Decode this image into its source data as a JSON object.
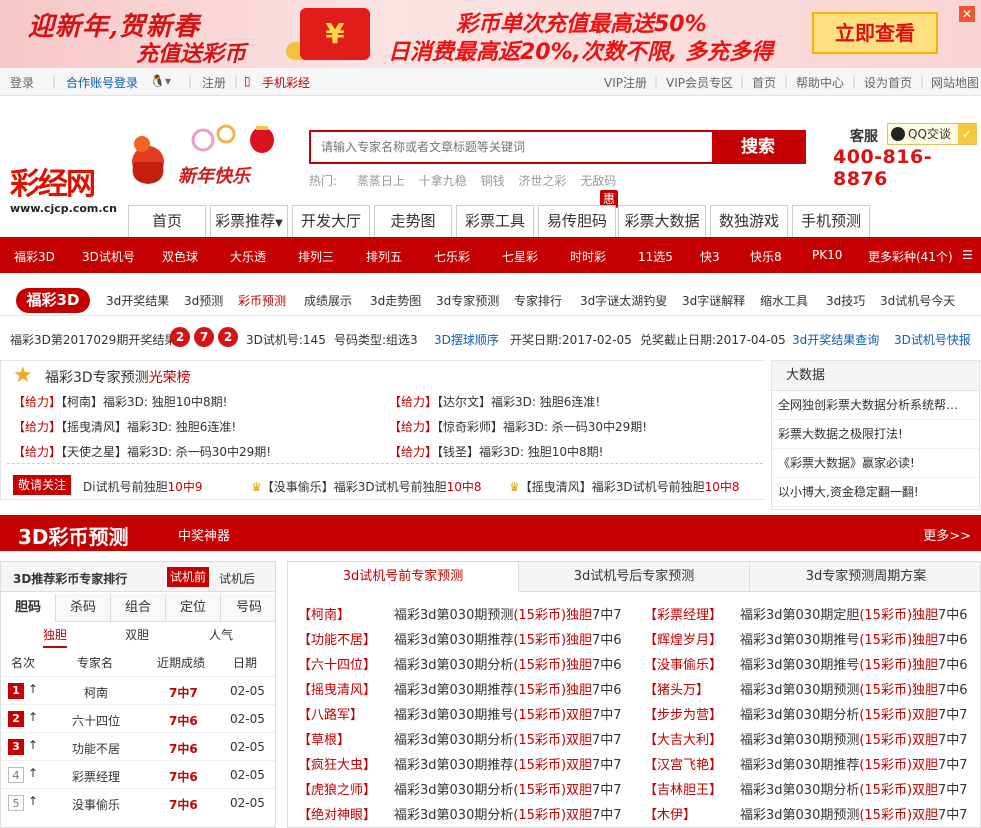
{
  "banner": {
    "title1": "迎新年,贺新春",
    "title2": "充值送彩币",
    "line1": "彩币单次充值最高送50%",
    "line2": "日消费最高返20%,次数不限, 多充多得",
    "cta": "立即查看",
    "envelope": "¥"
  },
  "topbar": {
    "login": "登录",
    "partner": "合作账号登录",
    "register": "注册",
    "mobile": "手机彩经",
    "vip_register": "VIP注册",
    "vip_zone": "VIP会员专区",
    "home": "首页",
    "help": "帮助中心",
    "set_home": "设为首页",
    "sitemap": "网站地图"
  },
  "header": {
    "logo_text": "彩经网",
    "logo_url": "www.cjcp.com.cn",
    "search_placeholder": "请输入专家名称或者文章标题等关键词",
    "search_btn": "搜索",
    "hot_label": "热门:",
    "hot": [
      "蒸蒸日上",
      "十拿九稳",
      "铜钱",
      "济世之彩",
      "无敌码"
    ],
    "kefu": "客服",
    "qq": "QQ交谈",
    "phone": "400-816-8876",
    "rooster_text": "新年快乐"
  },
  "mainnav": {
    "items": [
      "首页",
      "彩票推荐",
      "开发大厅",
      "走势图",
      "彩票工具",
      "易传胆码",
      "彩票大数据",
      "数独游戏",
      "手机预测"
    ],
    "badge": "惠"
  },
  "lotbar": {
    "items": [
      "福彩3D",
      "3D试机号",
      "双色球",
      "大乐透",
      "排列三",
      "排列五",
      "七乐彩",
      "七星彩",
      "时时彩",
      "11选5",
      "快3",
      "快乐8",
      "PK10",
      "更多彩种(41个)"
    ]
  },
  "subnav": {
    "pill": "福彩3D",
    "items": [
      "3d开奖结果",
      "3d预测",
      "彩币预测",
      "成绩展示",
      "3d走势图",
      "3d专家预测",
      "专家排行",
      "3d字谜太湖钓叟",
      "3d字谜解释",
      "缩水工具",
      "3d技巧",
      "3d试机号今天"
    ]
  },
  "result": {
    "issue": "福彩3D第2017029期开奖结果:",
    "balls": [
      "2",
      "7",
      "2"
    ],
    "test": "3D试机号:145",
    "type": "号码类型:组选3",
    "order": "3D摆球顺序",
    "date": "开奖日期:2017-02-05",
    "deadline": "兑奖截止日期:2017-04-05",
    "link1": "3d开奖结果查询",
    "link2": "3D试机号快报"
  },
  "experts": {
    "title_a": "福彩3D专家预测",
    "title_b": "光荣榜",
    "items": [
      {
        "tag": "【给力】",
        "name": "【柯南】",
        "text": "福彩3D: 独胆10中8期!"
      },
      {
        "tag": "【给力】",
        "name": "【达尔文】",
        "text": "福彩3D: 独胆6连准!"
      },
      {
        "tag": "【给力】",
        "name": "【摇曳清风】",
        "text": "福彩3D: 独胆6连准!"
      },
      {
        "tag": "【给力】",
        "name": "【惊奇彩师】",
        "text": "福彩3D: 杀一码30中29期!"
      },
      {
        "tag": "【给力】",
        "name": "【天使之星】",
        "text": "福彩3D: 杀一码30中29期!"
      },
      {
        "tag": "【给力】",
        "name": "【钱圣】",
        "text": "福彩3D: 独胆10中8期!"
      }
    ],
    "follow": "敬请关注",
    "f1a": "Di试机号前独胆",
    "f1b": "10中9",
    "f2a": "【没事偷乐】福彩3D试机号前独胆",
    "f2b": "10中8",
    "f3a": "【摇曳清风】福彩3D试机号前独胆",
    "f3b": "10中8"
  },
  "bigdata": {
    "title": "大数据",
    "rows": [
      "全网独创彩票大数据分析系统帮…",
      "彩票大数据之极限打法!",
      "《彩票大数据》赢家必读!",
      "以小博大,资金稳定翻一翻!"
    ]
  },
  "section": {
    "title": "3D彩币预测",
    "sub": "中奖神器",
    "more": "更多>>"
  },
  "rank": {
    "title": "3D推荐彩币专家排行",
    "before": "试机前",
    "after": "试机后",
    "tabs": [
      "胆码",
      "杀码",
      "组合",
      "定位",
      "号码"
    ],
    "subtabs": [
      "独胆",
      "双胆",
      "人气"
    ],
    "headers": [
      "名次",
      "专家名",
      "近期成绩",
      "日期"
    ],
    "rows": [
      {
        "n": "1",
        "name": "柯南",
        "res": "7中7",
        "date": "02-05"
      },
      {
        "n": "2",
        "name": "六十四位",
        "res": "7中6",
        "date": "02-05"
      },
      {
        "n": "3",
        "name": "功能不居",
        "res": "7中6",
        "date": "02-05"
      },
      {
        "n": "4",
        "name": "彩票经理",
        "res": "7中6",
        "date": "02-05"
      },
      {
        "n": "5",
        "name": "没事偷乐",
        "res": "7中6",
        "date": "02-05"
      }
    ],
    "arrow": "↑"
  },
  "pred": {
    "tabs": [
      "3d试机号前专家预测",
      "3d试机号后专家预测",
      "3d专家预测周期方案"
    ],
    "left": [
      {
        "n": "【柯南】",
        "a": "福彩3d第030期预测",
        "c": "(15彩币)独胆",
        "r": "7中7"
      },
      {
        "n": "【功能不居】",
        "a": "福彩3d第030期推荐",
        "c": "(15彩币)独胆",
        "r": "7中6"
      },
      {
        "n": "【六十四位】",
        "a": "福彩3d第030期分析",
        "c": "(15彩币)独胆",
        "r": "7中6"
      },
      {
        "n": "【摇曳清风】",
        "a": "福彩3d第030期推荐",
        "c": "(15彩币)独胆",
        "r": "7中6"
      },
      {
        "n": "【八路军】",
        "a": "福彩3d第030期推号",
        "c": "(15彩币)双胆",
        "r": "7中7"
      },
      {
        "n": "【草根】",
        "a": "福彩3d第030期分析",
        "c": "(15彩币)双胆",
        "r": "7中7"
      },
      {
        "n": "【疯狂大虫】",
        "a": "福彩3d第030期推荐",
        "c": "(15彩币)双胆",
        "r": "7中7"
      },
      {
        "n": "【虎狼之师】",
        "a": "福彩3d第030期分析",
        "c": "(15彩币)双胆",
        "r": "7中7"
      },
      {
        "n": "【绝对神眼】",
        "a": "福彩3d第030期分析",
        "c": "(15彩币)双胆",
        "r": "7中7"
      }
    ],
    "right": [
      {
        "n": "【彩票经理】",
        "a": "福彩3d第030期定胆",
        "c": "(15彩币)独胆",
        "r": "7中6"
      },
      {
        "n": "【辉煌岁月】",
        "a": "福彩3d第030期推号",
        "c": "(15彩币)独胆",
        "r": "7中6"
      },
      {
        "n": "【没事偷乐】",
        "a": "福彩3d第030期推号",
        "c": "(15彩币)独胆",
        "r": "7中6"
      },
      {
        "n": "【猪头万】",
        "a": "福彩3d第030期预测",
        "c": "(15彩币)独胆",
        "r": "7中6"
      },
      {
        "n": "【步步为营】",
        "a": "福彩3d第030期分析",
        "c": "(15彩币)双胆",
        "r": "7中7"
      },
      {
        "n": "【大吉大利】",
        "a": "福彩3d第030期预测",
        "c": "(15彩币)双胆",
        "r": "7中7"
      },
      {
        "n": "【汉宫飞艳】",
        "a": "福彩3d第030期推荐",
        "c": "(15彩币)双胆",
        "r": "7中7"
      },
      {
        "n": "【吉林胆王】",
        "a": "福彩3d第030期分析",
        "c": "(15彩币)双胆",
        "r": "7中7"
      },
      {
        "n": "【木伊】",
        "a": "福彩3d第030期预测",
        "c": "(15彩币)双胆",
        "r": "7中7"
      }
    ]
  }
}
